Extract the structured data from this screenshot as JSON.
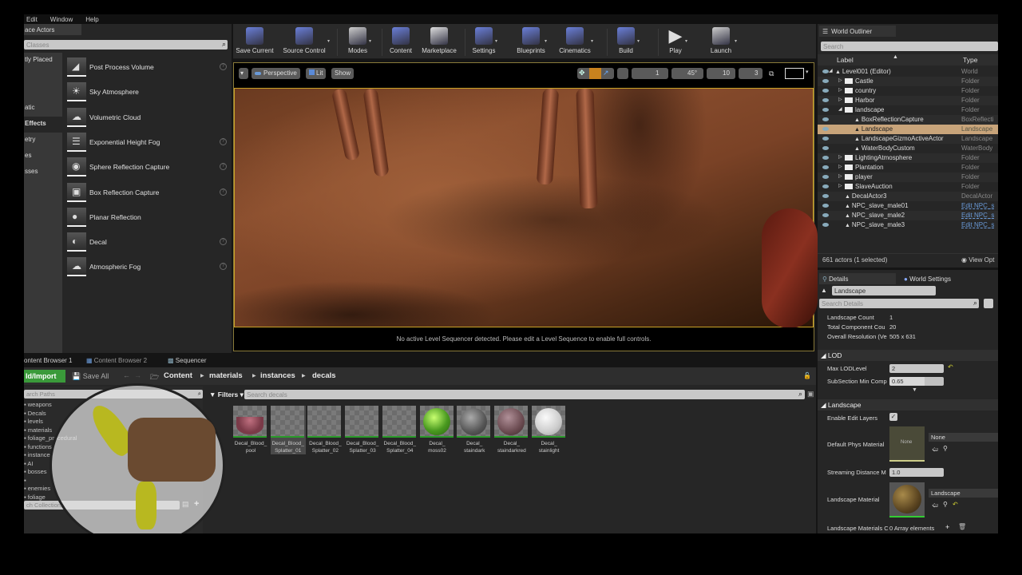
{
  "menu": [
    "Edit",
    "Window",
    "Help"
  ],
  "place_actors": {
    "tab": "ace Actors",
    "search_placeholder": "Classes",
    "categories": [
      {
        "label": "tly Placed",
        "active": false
      },
      {
        "label": "",
        "active": false
      },
      {
        "label": "",
        "active": false
      },
      {
        "label": "atic",
        "active": false
      },
      {
        "label": "Effects",
        "active": true
      },
      {
        "label": "etry",
        "active": false
      },
      {
        "label": "es",
        "active": false
      },
      {
        "label": "sses",
        "active": false
      }
    ],
    "items": [
      {
        "label": "Post Process Volume",
        "help": true
      },
      {
        "label": "Sky Atmosphere",
        "help": false
      },
      {
        "label": "Volumetric Cloud",
        "help": false
      },
      {
        "label": "Exponential Height Fog",
        "help": true
      },
      {
        "label": "Sphere Reflection Capture",
        "help": true
      },
      {
        "label": "Box Reflection Capture",
        "help": true
      },
      {
        "label": "Planar Reflection",
        "help": false
      },
      {
        "label": "Decal",
        "help": true
      },
      {
        "label": "Atmospheric Fog",
        "help": true
      }
    ]
  },
  "toolbar": {
    "buttons": [
      {
        "label": "Save Current",
        "icon": "save-icon",
        "color": "#6a7fd8"
      },
      {
        "label": "Source Control",
        "icon": "source-control-icon",
        "color": "#6a7fd8"
      },
      {
        "label": "Modes",
        "icon": "modes-icon",
        "color": "#cccccc"
      },
      {
        "label": "Content",
        "icon": "content-icon",
        "color": "#6a7fd8"
      },
      {
        "label": "Marketplace",
        "icon": "marketplace-icon",
        "color": "#dddddd"
      },
      {
        "label": "Settings",
        "icon": "settings-icon",
        "color": "#6a7fd8"
      },
      {
        "label": "Blueprints",
        "icon": "blueprints-icon",
        "color": "#6a7fd8"
      },
      {
        "label": "Cinematics",
        "icon": "cinematics-icon",
        "color": "#6a7fd8"
      },
      {
        "label": "Build",
        "icon": "build-icon",
        "color": "#6a7fd8"
      },
      {
        "label": "Play",
        "icon": "play-icon",
        "color": "#dddddd"
      },
      {
        "label": "Launch",
        "icon": "launch-icon",
        "color": "#cccccc"
      }
    ]
  },
  "viewport": {
    "view_mode": "Perspective",
    "lighting": "Lit",
    "show": "Show",
    "grid_snap": "1",
    "rotation_snap": "45°",
    "scale_snap": "10",
    "camera_speed": "3",
    "message": "No active Level Sequencer detected. Please edit a Level Sequence to enable full controls."
  },
  "outliner": {
    "tab": "World Outliner",
    "search_placeholder": "Search",
    "col_label": "Label",
    "col_type": "Type",
    "rows": [
      {
        "label": "Level001 (Editor)",
        "type": "World",
        "indent": 1,
        "icon": "level",
        "arrow": "open",
        "selected": false,
        "link": false
      },
      {
        "label": "Castle",
        "type": "Folder",
        "indent": 2,
        "icon": "folder",
        "arrow": "closed",
        "selected": false,
        "link": false
      },
      {
        "label": "country",
        "type": "Folder",
        "indent": 2,
        "icon": "folder",
        "arrow": "closed",
        "selected": false,
        "link": false
      },
      {
        "label": "Harbor",
        "type": "Folder",
        "indent": 2,
        "icon": "folder",
        "arrow": "closed",
        "selected": false,
        "link": false
      },
      {
        "label": "landscape",
        "type": "Folder",
        "indent": 2,
        "icon": "folder",
        "arrow": "open",
        "selected": false,
        "link": false
      },
      {
        "label": "BoxReflectionCapture",
        "type": "BoxReflecti",
        "indent": 3,
        "icon": "actor",
        "arrow": "",
        "selected": false,
        "link": false
      },
      {
        "label": "Landscape",
        "type": "Landscape",
        "indent": 3,
        "icon": "actor",
        "arrow": "",
        "selected": true,
        "link": false
      },
      {
        "label": "LandscapeGizmoActiveActor",
        "type": "Landscape",
        "indent": 3,
        "icon": "actor",
        "arrow": "",
        "selected": false,
        "link": false
      },
      {
        "label": "WaterBodyCustom",
        "type": "WaterBody",
        "indent": 3,
        "icon": "actor",
        "arrow": "",
        "selected": false,
        "link": false
      },
      {
        "label": "LightingAtmosphere",
        "type": "Folder",
        "indent": 2,
        "icon": "folder",
        "arrow": "closed",
        "selected": false,
        "link": false
      },
      {
        "label": "Plantation",
        "type": "Folder",
        "indent": 2,
        "icon": "folder",
        "arrow": "closed",
        "selected": false,
        "link": false
      },
      {
        "label": "player",
        "type": "Folder",
        "indent": 2,
        "icon": "folder",
        "arrow": "closed",
        "selected": false,
        "link": false
      },
      {
        "label": "SlaveAuction",
        "type": "Folder",
        "indent": 2,
        "icon": "folder",
        "arrow": "closed",
        "selected": false,
        "link": false
      },
      {
        "label": "DecalActor3",
        "type": "DecalActor",
        "indent": 2,
        "icon": "actor",
        "arrow": "",
        "selected": false,
        "link": false
      },
      {
        "label": "NPC_slave_male01",
        "type": "Edit NPC_s",
        "indent": 2,
        "icon": "actor",
        "arrow": "",
        "selected": false,
        "link": true
      },
      {
        "label": "NPC_slave_male2",
        "type": "Edit NPC_s",
        "indent": 2,
        "icon": "actor",
        "arrow": "",
        "selected": false,
        "link": true
      },
      {
        "label": "NPC_slave_male3",
        "type": "Edit NPC_s",
        "indent": 2,
        "icon": "actor",
        "arrow": "",
        "selected": false,
        "link": true
      }
    ],
    "footer": "661 actors (1 selected)",
    "view_options": "View Opt"
  },
  "details": {
    "tab_details": "Details",
    "tab_world_settings": "World Settings",
    "object_name": "Landscape",
    "search_placeholder": "Search Details",
    "info": [
      {
        "label": "Landscape Count",
        "value": "1"
      },
      {
        "label": "Total Component Cou",
        "value": "20"
      },
      {
        "label": "Overall Resolution (Ve",
        "value": "505 x 631"
      }
    ],
    "lod_section": "LOD",
    "max_lod_label": "Max LODLevel",
    "max_lod_value": "2",
    "subsection_label": "SubSection Min Comp",
    "subsection_value": "0.65",
    "landscape_section": "Landscape",
    "edit_layers_label": "Enable Edit Layers",
    "edit_layers_checked": true,
    "phys_mat_label": "Default Phys Material",
    "phys_mat_thumb": "None",
    "phys_mat_value": "None",
    "streaming_label": "Streaming Distance M",
    "streaming_value": "1.0",
    "material_label": "Landscape Material",
    "material_value": "Landscape",
    "materials_array_label": "Landscape Materials C",
    "materials_array_value": "0 Array elements"
  },
  "bottom_tabs": [
    "ontent Browser 1",
    "Content Browser 2",
    "Sequencer"
  ],
  "content_browser": {
    "add_import": "ld/Import",
    "save_all": "Save All",
    "breadcrumb": [
      "Content",
      "materials",
      "instances",
      "decals"
    ],
    "sources_search_placeholder": "arch Paths",
    "tree": [
      "weapons",
      "Decals",
      "levels",
      "materials",
      "foliage_procedural",
      "functions",
      "instances",
      "AI",
      "bosses",
      "",
      "enemies",
      "foliage"
    ],
    "collections_placeholder": "ch Collections",
    "filters": "Filters",
    "search_placeholder": "Search decals",
    "assets": [
      {
        "name": "Decal_Blood_\npool",
        "kind": "pool",
        "selected": false
      },
      {
        "name": "Decal_Blood_\nSplatter_01",
        "kind": "splatter1",
        "selected": true
      },
      {
        "name": "Decal_Blood_\nSplatter_02",
        "kind": "splatter2",
        "selected": false
      },
      {
        "name": "Decal_Blood_\nSplatter_03",
        "kind": "empty",
        "selected": false
      },
      {
        "name": "Decal_Blood_\nSplatter_04",
        "kind": "splatter4",
        "selected": false
      },
      {
        "name": "Decal_\nmoss02",
        "kind": "moss",
        "selected": false
      },
      {
        "name": "Decal_\nstaindark",
        "kind": "staindark",
        "selected": false
      },
      {
        "name": "Decal_\nstaindarkred",
        "kind": "staindarkred",
        "selected": false
      },
      {
        "name": "Decal_\nstainlight",
        "kind": "stainlight",
        "selected": false
      }
    ]
  }
}
